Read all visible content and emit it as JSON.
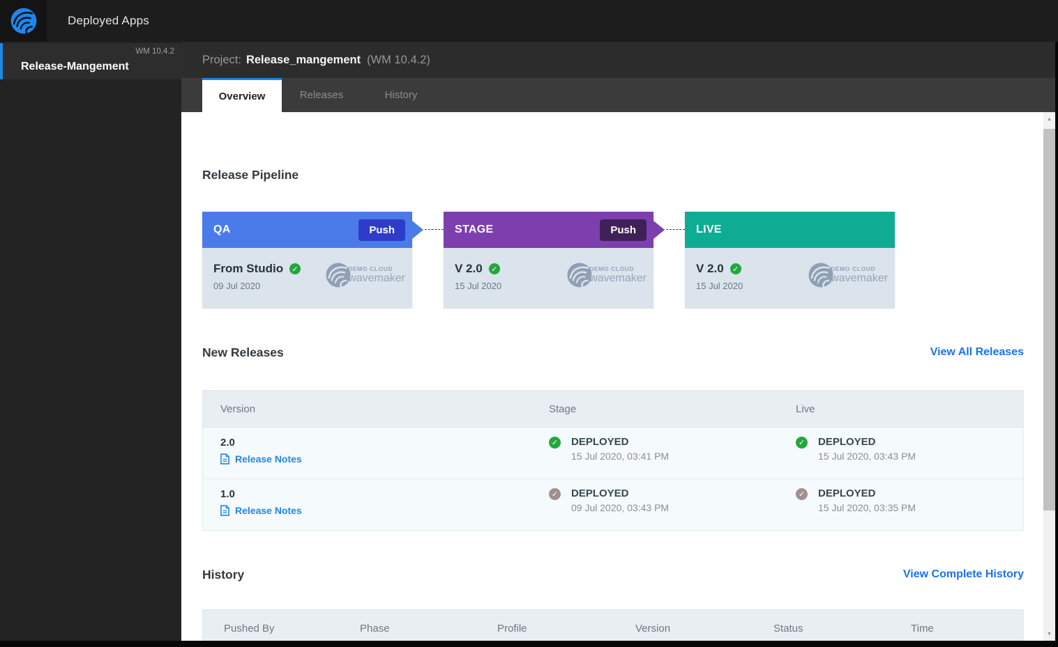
{
  "topbar": {
    "title": "Deployed Apps"
  },
  "sidebar": {
    "project": {
      "name": "Release-Mangement",
      "version": "WM 10.4.2"
    }
  },
  "header": {
    "project_label": "Project:",
    "project_name": "Release_mangement",
    "project_version": "(WM 10.4.2)"
  },
  "tabs": [
    {
      "label": "Overview",
      "active": true
    },
    {
      "label": "Releases",
      "active": false
    },
    {
      "label": "History",
      "active": false
    }
  ],
  "pipeline": {
    "title": "Release Pipeline",
    "logo": {
      "line1": "DEMO CLOUD",
      "line2": "wavemaker"
    },
    "stages": [
      {
        "name": "QA",
        "push_label": "Push",
        "version": "From Studio",
        "date": "09 Jul 2020",
        "header_color": "#4b7be9",
        "push_color": "#2e3cc9"
      },
      {
        "name": "STAGE",
        "push_label": "Push",
        "version": "V 2.0",
        "date": "15 Jul 2020",
        "header_color": "#7d3fad",
        "push_color": "#3f2158"
      },
      {
        "name": "LIVE",
        "version": "V 2.0",
        "date": "15 Jul 2020",
        "header_color": "#0ead93"
      }
    ]
  },
  "new_releases": {
    "title": "New Releases",
    "view_all": "View All Releases",
    "columns": [
      "Version",
      "Stage",
      "Live"
    ],
    "rows": [
      {
        "version": "2.0",
        "release_notes": "Release Notes",
        "stage": {
          "status": "DEPLOYED",
          "time": "15 Jul 2020, 03:41 PM",
          "icon": "success-green"
        },
        "live": {
          "status": "DEPLOYED",
          "time": "15 Jul 2020, 03:43 PM",
          "icon": "success-green"
        }
      },
      {
        "version": "1.0",
        "release_notes": "Release Notes",
        "stage": {
          "status": "DEPLOYED",
          "time": "09 Jul 2020, 03:43 PM",
          "icon": "success-muted"
        },
        "live": {
          "status": "DEPLOYED",
          "time": "15 Jul 2020, 03:35 PM",
          "icon": "success-muted"
        }
      }
    ]
  },
  "history": {
    "title": "History",
    "view_all": "View Complete History",
    "columns": [
      "Pushed By",
      "Phase",
      "Profile",
      "Version",
      "Status",
      "Time"
    ]
  },
  "colors": {
    "accent_blue": "#1787e8",
    "link_blue": "#1a73e8",
    "qa_header": "#4b7be9",
    "qa_push": "#2e3cc9",
    "stage_header": "#7d3fad",
    "stage_push": "#3f2158",
    "live_header": "#0ead93",
    "success_green": "#23a73c",
    "success_muted": "#a18f8f",
    "card_body": "#dbe3ed",
    "table_header_bg": "#e9eef3",
    "table_row_bg": "#f5fafd"
  }
}
